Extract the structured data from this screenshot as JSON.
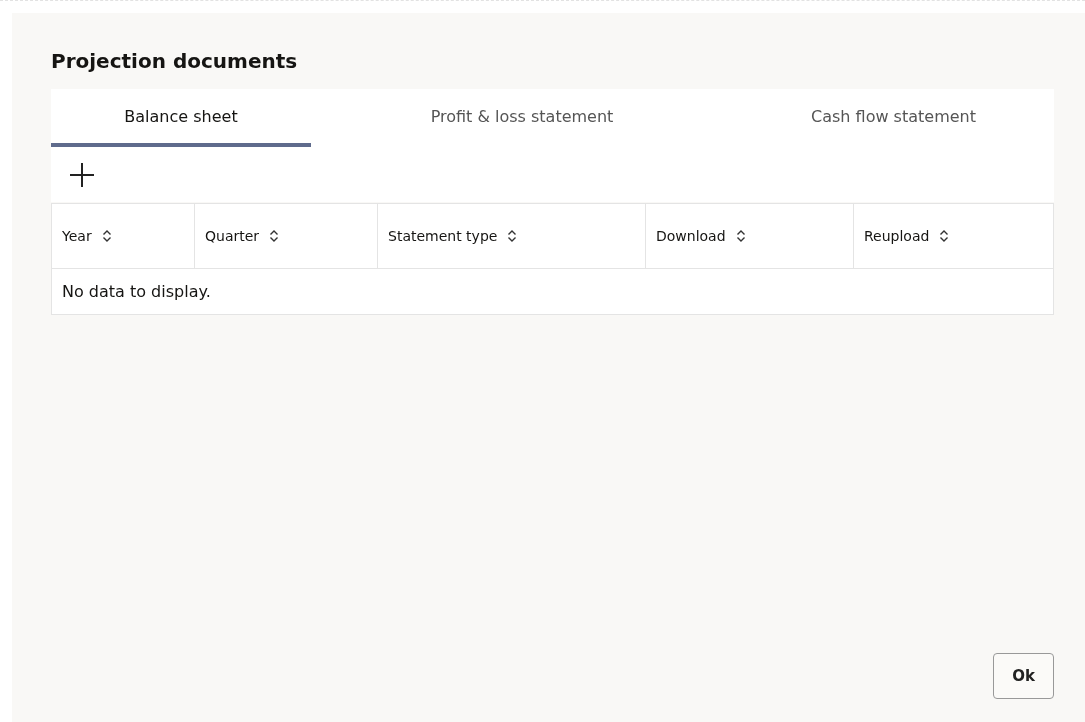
{
  "dialog": {
    "title": "Projection documents"
  },
  "tabs": [
    {
      "label": "Balance sheet",
      "selected": true
    },
    {
      "label": "Profit & loss statement",
      "selected": false
    },
    {
      "label": "Cash flow statement",
      "selected": false
    }
  ],
  "table": {
    "columns": [
      "Year",
      "Quarter",
      "Statement type",
      "Download",
      "Reupload"
    ],
    "empty_message": "No data to display."
  },
  "buttons": [
    "Ok"
  ]
}
